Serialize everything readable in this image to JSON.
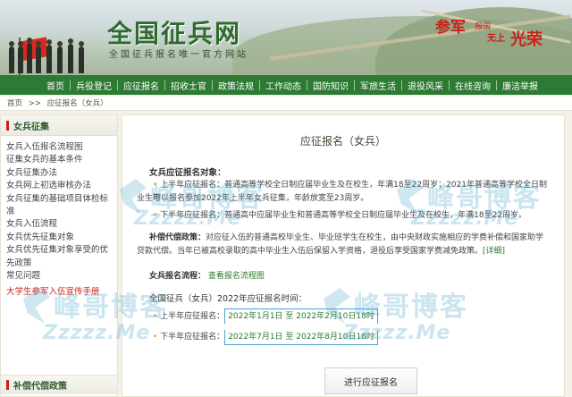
{
  "banner": {
    "logo": "全国征兵网",
    "slogan": "全国征兵报名唯一官方网站",
    "badge_a": "参军",
    "badge_b": "报国",
    "badge_c": "无上",
    "badge_d": "光荣"
  },
  "nav": {
    "items": [
      "首页",
      "兵役登记",
      "应征报名",
      "招收士官",
      "政策法规",
      "工作动态",
      "国防知识",
      "军旅生活",
      "退役风采",
      "在线咨询",
      "廉洁举报"
    ]
  },
  "breadcrumb": {
    "home": "首页",
    "sep": ">>",
    "current": "应征报名（女兵）"
  },
  "sidebar": {
    "heading": "女兵征集",
    "items": [
      "女兵入伍报名流程图",
      "征集女兵的基本条件",
      "女兵征集办法",
      "女兵网上初选审核办法",
      "女兵征集的基础项目体检标",
      "准",
      "女兵入伍流程",
      "女兵优先征集对象",
      "女兵优先征集对象享受的优",
      "先政策",
      "常见问题"
    ],
    "red_item": "大学生参军入伍宣传手册",
    "heading2": "补偿代偿政策"
  },
  "main": {
    "title": "应征报名（女兵）",
    "sec1_title": "女兵应征报名对象：",
    "sec1_p1": "上半年应征报名：普通高等学校全日制应届毕业生及在校生，年满18至22周岁；2021年普通高等学校全日制毕",
    "sec1_p1b": "业生可以报名参加2022年上半年女兵征集，年龄放宽至23周岁。",
    "sec1_p2": "下半年应征报名：普通高中应届毕业生和普通高等学校全日制应届毕业生及在校生，年满18至22周岁。",
    "sec2_label": "补偿代偿政策：",
    "sec2_text": "对应征入伍的普通高校毕业生、毕业班学生在校生，由中央财政实施相应的学费补偿和国家助学",
    "sec2_text2": "贷款代偿。当年已被高校录取的高中毕业生入伍后保留入学资格，退役后享受国家学费减免政策。",
    "sec2_link": "[详细]",
    "sec3_label": "女兵报名流程：",
    "sec3_link": "查看报名流程图",
    "sec4_title": "全国征兵（女兵）2022年应征报名时间：",
    "first_label": "上半年应征报名：",
    "first_time": "2022年1月1日 至 2022年2月10日18时",
    "second_label": "下半年应征报名：",
    "second_time": "2022年7月1日 至 2022年8月10日18时",
    "submit": "进行应征报名"
  },
  "watermark": {
    "cn": "峰哥博客",
    "en": "Zzzzz.Me"
  },
  "colors": {
    "nav_green": "#2d7a33",
    "accent_red": "#c9221a",
    "highlight_box": "#4aa3c9"
  }
}
